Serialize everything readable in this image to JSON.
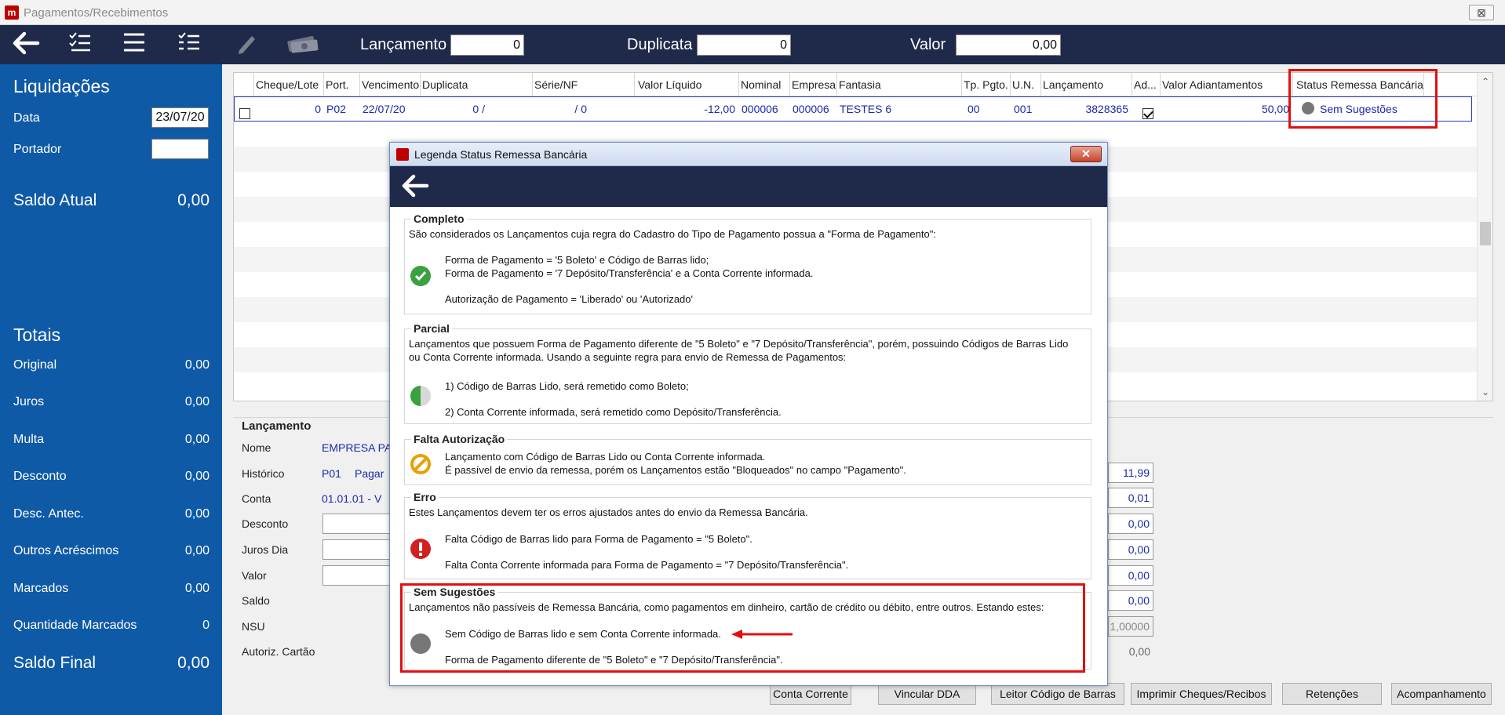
{
  "window": {
    "title": "Pagamentos/Recebimentos",
    "close_label": "⊠"
  },
  "toolbar": {
    "lancamento_label": "Lançamento",
    "lancamento_value": "0",
    "duplicata_label": "Duplicata",
    "duplicata_value": "0",
    "valor_label": "Valor",
    "valor_value": "0,00"
  },
  "sidebar": {
    "liquidacoes_title": "Liquidações",
    "data_label": "Data",
    "data_value": "23/07/20",
    "portador_label": "Portador",
    "saldo_atual_label": "Saldo Atual",
    "saldo_atual_value": "0,00",
    "totais_title": "Totais",
    "totais": [
      {
        "label": "Original",
        "value": "0,00"
      },
      {
        "label": "Juros",
        "value": "0,00"
      },
      {
        "label": "Multa",
        "value": "0,00"
      },
      {
        "label": "Desconto",
        "value": "0,00"
      },
      {
        "label": "Desc. Antec.",
        "value": "0,00"
      },
      {
        "label": "Outros Acréscimos",
        "value": "0,00"
      },
      {
        "label": "Marcados",
        "value": "0,00"
      },
      {
        "label": "Quantidade Marcados",
        "value": "0"
      }
    ],
    "saldo_final_label": "Saldo Final",
    "saldo_final_value": "0,00"
  },
  "grid": {
    "headers": [
      "Cheque/Lote",
      "Port.",
      "Vencimento",
      "Duplicata",
      "Série/NF",
      "Valor Líquido",
      "Nominal",
      "Empresa",
      "Fantasia",
      "Tp. Pgto.",
      "U.N.",
      "Lançamento",
      "Ad...",
      "Valor Adiantamentos",
      "Status Remessa Bancária"
    ],
    "row": {
      "cheque": "0",
      "port": "P02",
      "vencimento": "22/07/20",
      "duplicata": "0 /",
      "serie": "/ 0",
      "valor_liquido": "-12,00",
      "nominal": "000006",
      "empresa": "000006",
      "fantasia": "TESTES 6",
      "tp_pgto": "00",
      "un": "001",
      "lancamento": "3828365",
      "valor_adiantamentos": "50,00",
      "status": "Sem Sugestões"
    }
  },
  "lancamento_panel": {
    "title": "Lançamento",
    "nome_label": "Nome",
    "nome_value": "EMPRESA PAR",
    "historico_label": "Histórico",
    "historico_code": "P01",
    "historico_value": "Pagar",
    "conta_label": "Conta",
    "conta_value": "01.01.01 - V",
    "desconto_label": "Desconto",
    "juros_dia_label": "Juros Dia",
    "valor_label": "Valor",
    "saldo_label": "Saldo",
    "nsu_label": "NSU",
    "autoriz_label": "Autoriz. Cartão",
    "right_values": [
      "11,99",
      "0,01",
      "0,00",
      "0,00",
      "0,00",
      "0,00",
      "1,00000",
      "0,00"
    ]
  },
  "buttons": {
    "conta_corrente": "Conta Corrente",
    "vincular_dda": "Vincular DDA",
    "leitor": "Leitor Código de Barras",
    "imprimir": "Imprimir Cheques/Recibos",
    "retencoes": "Retenções",
    "acompanhamento": "Acompanhamento"
  },
  "dialog": {
    "title": "Legenda Status Remessa Bancária",
    "completo": {
      "heading": "Completo",
      "intro": "São considerados os Lançamentos cuja regra do Cadastro do Tipo de Pagamento possua a \"Forma de Pagamento\":",
      "line1": "Forma de Pagamento = '5 Boleto' e Código de Barras lido;",
      "line2": "Forma de Pagamento = '7 Depósito/Transferência' e a Conta Corrente informada.",
      "line3": "Autorização de Pagamento = 'Liberado' ou 'Autorizado'"
    },
    "parcial": {
      "heading": "Parcial",
      "intro1": "Lançamentos que possuem Forma de Pagamento diferente de \"5 Boleto\" e \"7 Depósito/Transferência\", porém, possuindo Códigos de Barras Lido",
      "intro2": "ou Conta Corrente informada. Usando a seguinte regra para envio de Remessa de Pagamentos:",
      "line1": "1) Código de Barras Lido, será remetido como Boleto;",
      "line2": "2) Conta Corrente informada, será remetido como Depósito/Transferência."
    },
    "falta": {
      "heading": "Falta Autorização",
      "line1": "Lançamento com Código de Barras Lido ou Conta Corrente informada.",
      "line2": "É passível de envio da remessa, porém os Lançamentos estão \"Bloqueados\" no campo \"Pagamento\"."
    },
    "erro": {
      "heading": "Erro",
      "intro": "Estes Lançamentos devem ter os erros ajustados antes do envio da Remessa Bancária.",
      "line1": "Falta Código de Barras lido para Forma de Pagamento = \"5 Boleto\".",
      "line2": "Falta Conta Corrente informada para Forma de Pagamento = \"7 Depósito/Transferência\"."
    },
    "sem": {
      "heading": "Sem Sugestões",
      "intro": "Lançamentos não passíveis de Remessa Bancária, como pagamentos em dinheiro, cartão de crédito ou débito, entre outros. Estando estes:",
      "line1": "Sem Código de Barras lido e sem Conta Corrente informada.",
      "line2": "Forma de Pagamento diferente de \"5 Boleto\" e \"7 Depósito/Transferência\"."
    }
  },
  "colors": {
    "toolbar": "#1f2a4a",
    "sidebar": "#0f5aa6",
    "highlight": "#e01010",
    "status_gray": "#777777",
    "ok_green": "#3aa040",
    "warn_orange": "#e8a000",
    "error_red": "#d02020"
  }
}
